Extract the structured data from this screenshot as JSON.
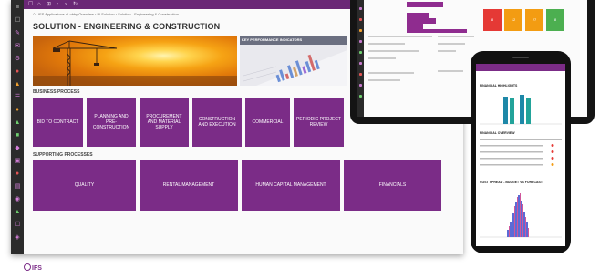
{
  "window": {
    "breadcrumb": "IFS Applications › Lobby Overview › Bl Solution › Solution - Engineering & Construction",
    "page_title": "SOLUTION - ENGINEERING & CONSTRUCTION"
  },
  "kpi_panel": {
    "title": "KEY PERFORMANCE INDICATORS"
  },
  "sections": {
    "business": "BUSINESS PROCESS",
    "supporting": "SUPPORTING PROCESSES"
  },
  "business_tiles": [
    {
      "label": "BID TO CONTRACT"
    },
    {
      "label": "PLANNING AND PRE-CONSTRUCTION"
    },
    {
      "label": "PROCUREMENT AND MATERIAL SUPPLY"
    },
    {
      "label": "CONSTRUCTION AND EXECUTION"
    },
    {
      "label": "COMMERCIAL"
    },
    {
      "label": "PERIODIC PROJECT REVIEW"
    }
  ],
  "supporting_tiles": [
    {
      "label": "QUALITY"
    },
    {
      "label": "RENTAL MANAGEMENT"
    },
    {
      "label": "HUMAN CAPITAL MANAGEMENT"
    },
    {
      "label": "FINANCIALS"
    }
  ],
  "tablet": {
    "status_values": [
      "8",
      "12",
      "27",
      "8"
    ],
    "status_colors": [
      "#e53935",
      "#f39c12",
      "#f39c12",
      "#4caf50"
    ]
  },
  "phone": {
    "financial_highlights": "FINANCIAL HIGHLIGHTS",
    "financial_overview": "FINANCIAL OVERVIEW",
    "cost_spread": "COST SPREAD - BUDGET VS FORECAST"
  },
  "brand": {
    "logo_text": "IFS",
    "accent": "#7b2c87"
  },
  "icons": [
    "menu-icon",
    "bookmark-icon",
    "home-icon",
    "back-icon",
    "forward-icon",
    "refresh-icon"
  ]
}
